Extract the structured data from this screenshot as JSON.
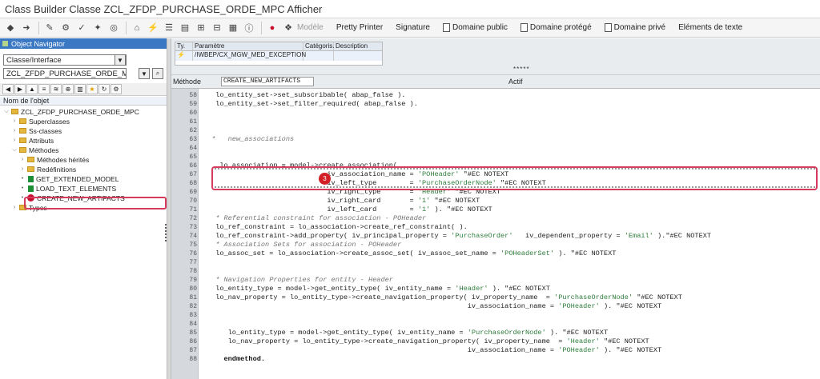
{
  "window": {
    "title": "Class Builder Classe ZCL_ZFDP_PURCHASE_ORDE_MPC Afficher"
  },
  "toolbar": {
    "labels": [
      "Modèle",
      "Pretty Printer",
      "Signature",
      "Domaine public",
      "Domaine protégé",
      "Domaine privé",
      "Eléments de texte"
    ]
  },
  "navigator": {
    "title": "Object Navigator",
    "type_value": "Classe/Interface",
    "object_value": "ZCL_ZFDP_PURCHASE_ORDE_MPC",
    "column_header": "Nom de l'objet",
    "tree": [
      {
        "label": "ZCL_ZFDP_PURCHASE_ORDE_MPC",
        "icon": "folder-icon"
      },
      {
        "label": "Superclasses",
        "icon": "folder-icon"
      },
      {
        "label": "Ss-classes",
        "icon": "folder-icon"
      },
      {
        "label": "Attributs",
        "icon": "folder-icon"
      },
      {
        "label": "Méthodes",
        "icon": "folder-icon"
      },
      {
        "label": "Méthodes hérités",
        "icon": "folder-icon"
      },
      {
        "label": "Redéfinitions",
        "icon": "folder-icon"
      },
      {
        "label": "GET_EXTENDED_MODEL",
        "icon": "method-icon"
      },
      {
        "label": "LOAD_TEXT_ELEMENTS",
        "icon": "method-icon"
      },
      {
        "label": "CREATE_NEW_ARTIFACTS",
        "icon": "new-method-icon"
      },
      {
        "label": "Types",
        "icon": "folder-icon"
      }
    ]
  },
  "exceptions": {
    "headers": [
      "Ty.",
      "Paramètre",
      "Catégoris.",
      "Description"
    ],
    "row": {
      "type_icon": "lightning-icon",
      "param": "/IWBEP/CX_MGW_MED_EXCEPTION",
      "category": "",
      "description": ""
    },
    "stars": "*****"
  },
  "method_bar": {
    "label": "Méthode",
    "value": "CREATE_NEW_ARTIFACTS",
    "status": "Actif"
  },
  "annotation": {
    "badge": "3"
  },
  "code": [
    {
      "n": "58",
      "t": " lo_entity_set->set_subscribable( abap_false )."
    },
    {
      "n": "59",
      "t": " lo_entity_set->set_filter_required( abap_false )."
    },
    {
      "n": "60",
      "t": ""
    },
    {
      "n": "61",
      "t": ""
    },
    {
      "n": "62",
      "t": ""
    },
    {
      "n": "63",
      "t": "*   new_associations",
      "c": "cm"
    },
    {
      "n": "64",
      "t": ""
    },
    {
      "n": "65",
      "t": ""
    },
    {
      "n": "66",
      "t": "  lo_association = model->create_association("
    },
    {
      "n": "67",
      "t": "                            iv_association_name = 'POHeader' \"#EC NOTEXT"
    },
    {
      "n": "68",
      "t": "                            iv_left_type        = 'PurchaseOrderNode' \"#EC NOTEXT"
    },
    {
      "n": "69",
      "t": "                            iv_right_type       = 'Header' \"#EC NOTEXT"
    },
    {
      "n": "70",
      "t": "                            iv_right_card       = '1' \"#EC NOTEXT"
    },
    {
      "n": "71",
      "t": "                            iv_left_card        = '1' ). \"#EC NOTEXT"
    },
    {
      "n": "72",
      "t": " * Referential constraint for association - POHeader",
      "c": "cm"
    },
    {
      "n": "73",
      "t": " lo_ref_constraint = lo_association->create_ref_constraint( )."
    },
    {
      "n": "74",
      "t": " lo_ref_constraint->add_property( iv_principal_property = 'PurchaseOrder'   iv_dependent_property = 'Email' ).\"#EC NOTEXT"
    },
    {
      "n": "75",
      "t": " * Association Sets for association - POHeader",
      "c": "cm"
    },
    {
      "n": "76",
      "t": " lo_assoc_set = lo_association->create_assoc_set( iv_assoc_set_name = 'POHeaderSet' ). \"#EC NOTEXT"
    },
    {
      "n": "77",
      "t": ""
    },
    {
      "n": "78",
      "t": ""
    },
    {
      "n": "79",
      "t": " * Navigation Properties for entity - Header",
      "c": "cm"
    },
    {
      "n": "80",
      "t": " lo_entity_type = model->get_entity_type( iv_entity_name = 'Header' ). \"#EC NOTEXT"
    },
    {
      "n": "81",
      "t": " lo_nav_property = lo_entity_type->create_navigation_property( iv_property_name  = 'PurchaseOrderNode' \"#EC NOTEXT"
    },
    {
      "n": "82",
      "t": "                                                              iv_association_name = 'POHeader' ). \"#EC NOTEXT"
    },
    {
      "n": "83",
      "t": ""
    },
    {
      "n": "84",
      "t": ""
    },
    {
      "n": "85",
      "t": "    lo_entity_type = model->get_entity_type( iv_entity_name = 'PurchaseOrderNode' ). \"#EC NOTEXT"
    },
    {
      "n": "86",
      "t": "    lo_nav_property = lo_entity_type->create_navigation_property( iv_property_name  = 'Header' \"#EC NOTEXT"
    },
    {
      "n": "87",
      "t": "                                                              iv_association_name = 'POHeader' ). \"#EC NOTEXT"
    },
    {
      "n": "88",
      "t": "   endmethod.",
      "c": "kw"
    }
  ]
}
